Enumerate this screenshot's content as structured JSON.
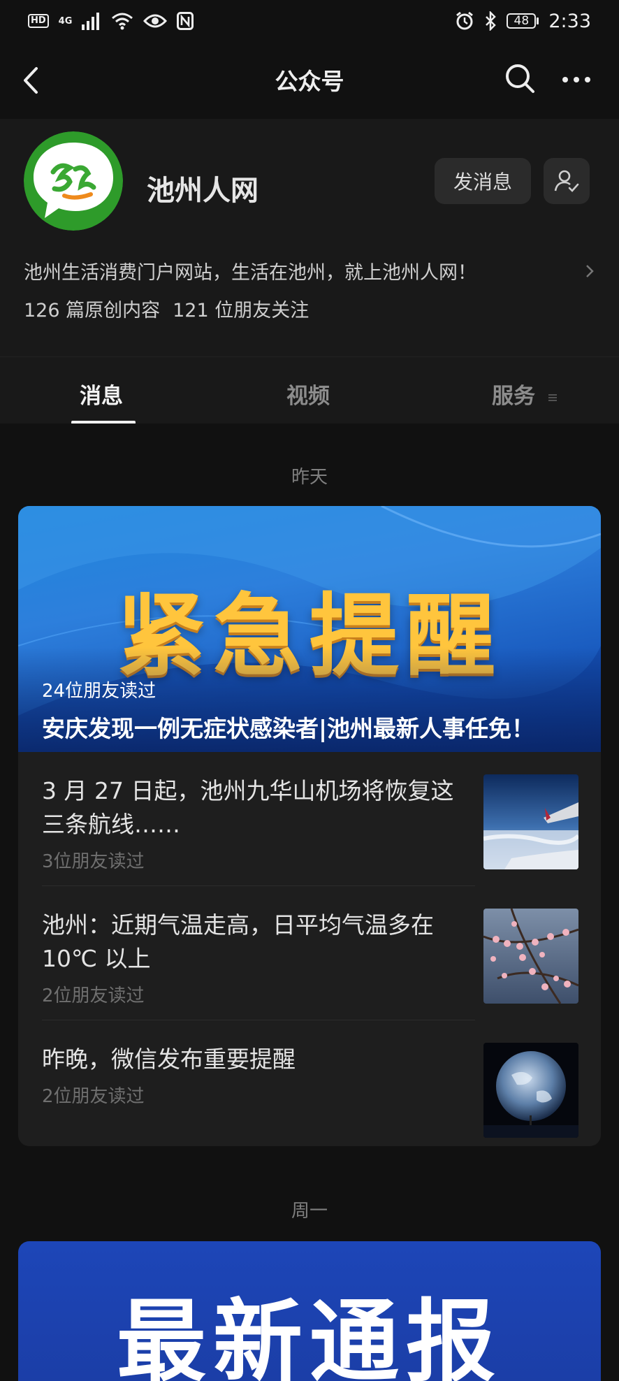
{
  "status_bar": {
    "hd": "HD",
    "network": "4G",
    "battery": "48",
    "time": "2:33"
  },
  "nav": {
    "title": "公众号"
  },
  "account": {
    "name": "池州人网",
    "message_button": "发消息",
    "description": "池州生活消费门户网站，生活在池州，就上池州人网！",
    "original_count": "126 篇原创内容",
    "followers": "121 位朋友关注"
  },
  "tabs": [
    {
      "label": "消息",
      "active": true
    },
    {
      "label": "视频",
      "active": false
    },
    {
      "label": "服务",
      "active": false
    }
  ],
  "feed": {
    "groups": [
      {
        "date": "昨天",
        "headline": {
          "banner_text": "紧急提醒",
          "reads": "24位朋友读过",
          "title": "安庆发现一例无症状感染者|池州最新人事任免！"
        },
        "items": [
          {
            "title": "3 月 27 日起，池州九华山机场将恢复这三条航线……",
            "reads": "3位朋友读过",
            "thumb": "airplane-wing"
          },
          {
            "title": "池州：近期气温走高，日平均气温多在 10℃ 以上",
            "reads": "2位朋友读过",
            "thumb": "plum-blossom"
          },
          {
            "title": "昨晚，微信发布重要提醒",
            "reads": "2位朋友读过",
            "thumb": "earth-moon"
          }
        ]
      },
      {
        "date": "周一",
        "headline": {
          "banner_text": "最新通报"
        }
      }
    ]
  },
  "colors": {
    "background": "#111111",
    "card": "#1e1e1e",
    "banner_blue": "#1f86dc",
    "banner_text_gold": "#ffc53d",
    "logo_green": "#2e9b2a"
  }
}
